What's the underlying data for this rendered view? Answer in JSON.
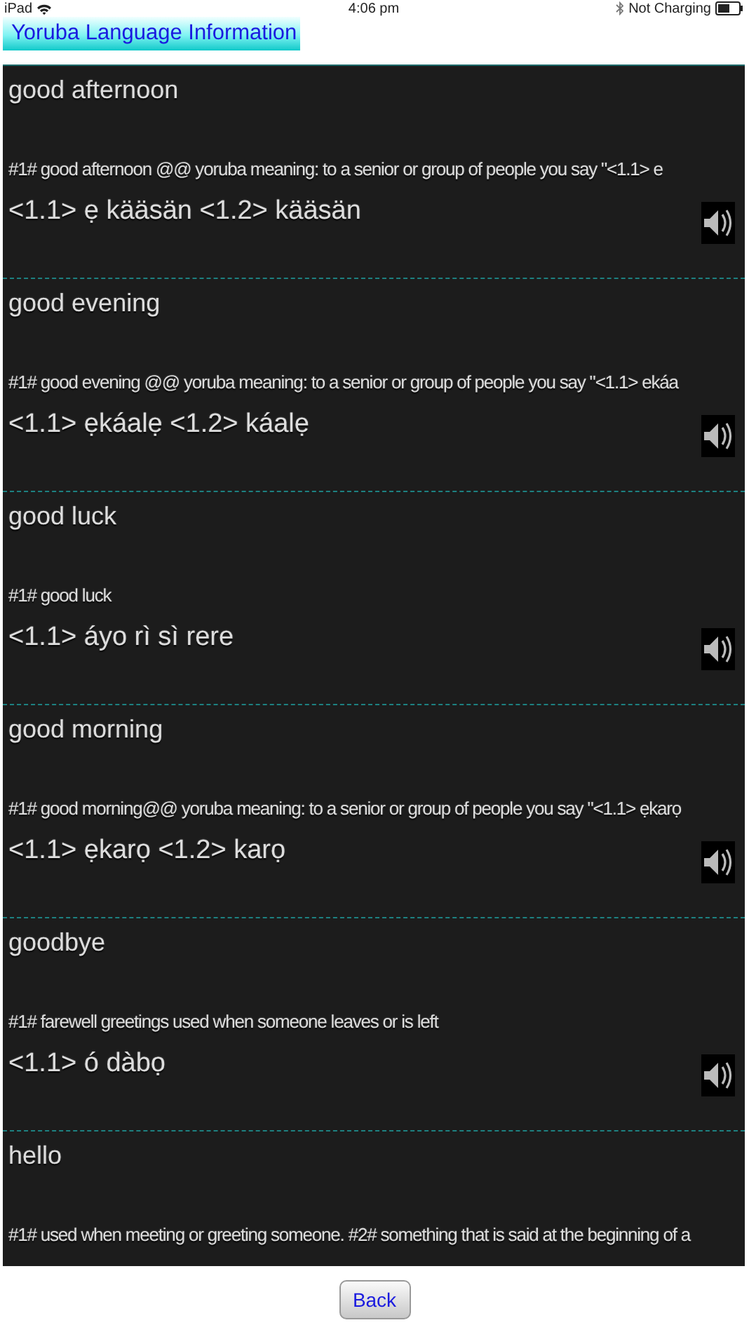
{
  "status_bar": {
    "device": "iPad",
    "time": "4:06 pm",
    "battery_text": "Not Charging"
  },
  "title": "Yoruba Language Information",
  "entries": [
    {
      "phrase": "good afternoon",
      "description": "#1# good afternoon @@  yoruba meaning:   to a senior or group of people you say  \"<1.1> e",
      "translation": "<1.1> ẹ kääsän <1.2> kääsän"
    },
    {
      "phrase": "good evening",
      "description": "#1# good evening @@  yoruba meaning:   to a senior or group of people you say \"<1.1> ekáa",
      "translation": "<1.1> ẹkáalẹ <1.2> káalẹ"
    },
    {
      "phrase": "good luck",
      "description": "#1# good luck",
      "translation": "<1.1> áyo rì sì rere"
    },
    {
      "phrase": "good morning",
      "description": "#1# good morning@@  yoruba meaning:   to a senior or group of people you say \"<1.1> ẹkarọ",
      "translation": "<1.1> ẹkarọ <1.2> karọ"
    },
    {
      "phrase": "goodbye",
      "description": "#1# farewell greetings used when someone leaves or is left",
      "translation": "<1.1> ó dàbọ"
    },
    {
      "phrase": "hello",
      "description": "#1# used when meeting or greeting someone. #2# something that is said at the beginning of a"
    }
  ],
  "back_button": "Back"
}
